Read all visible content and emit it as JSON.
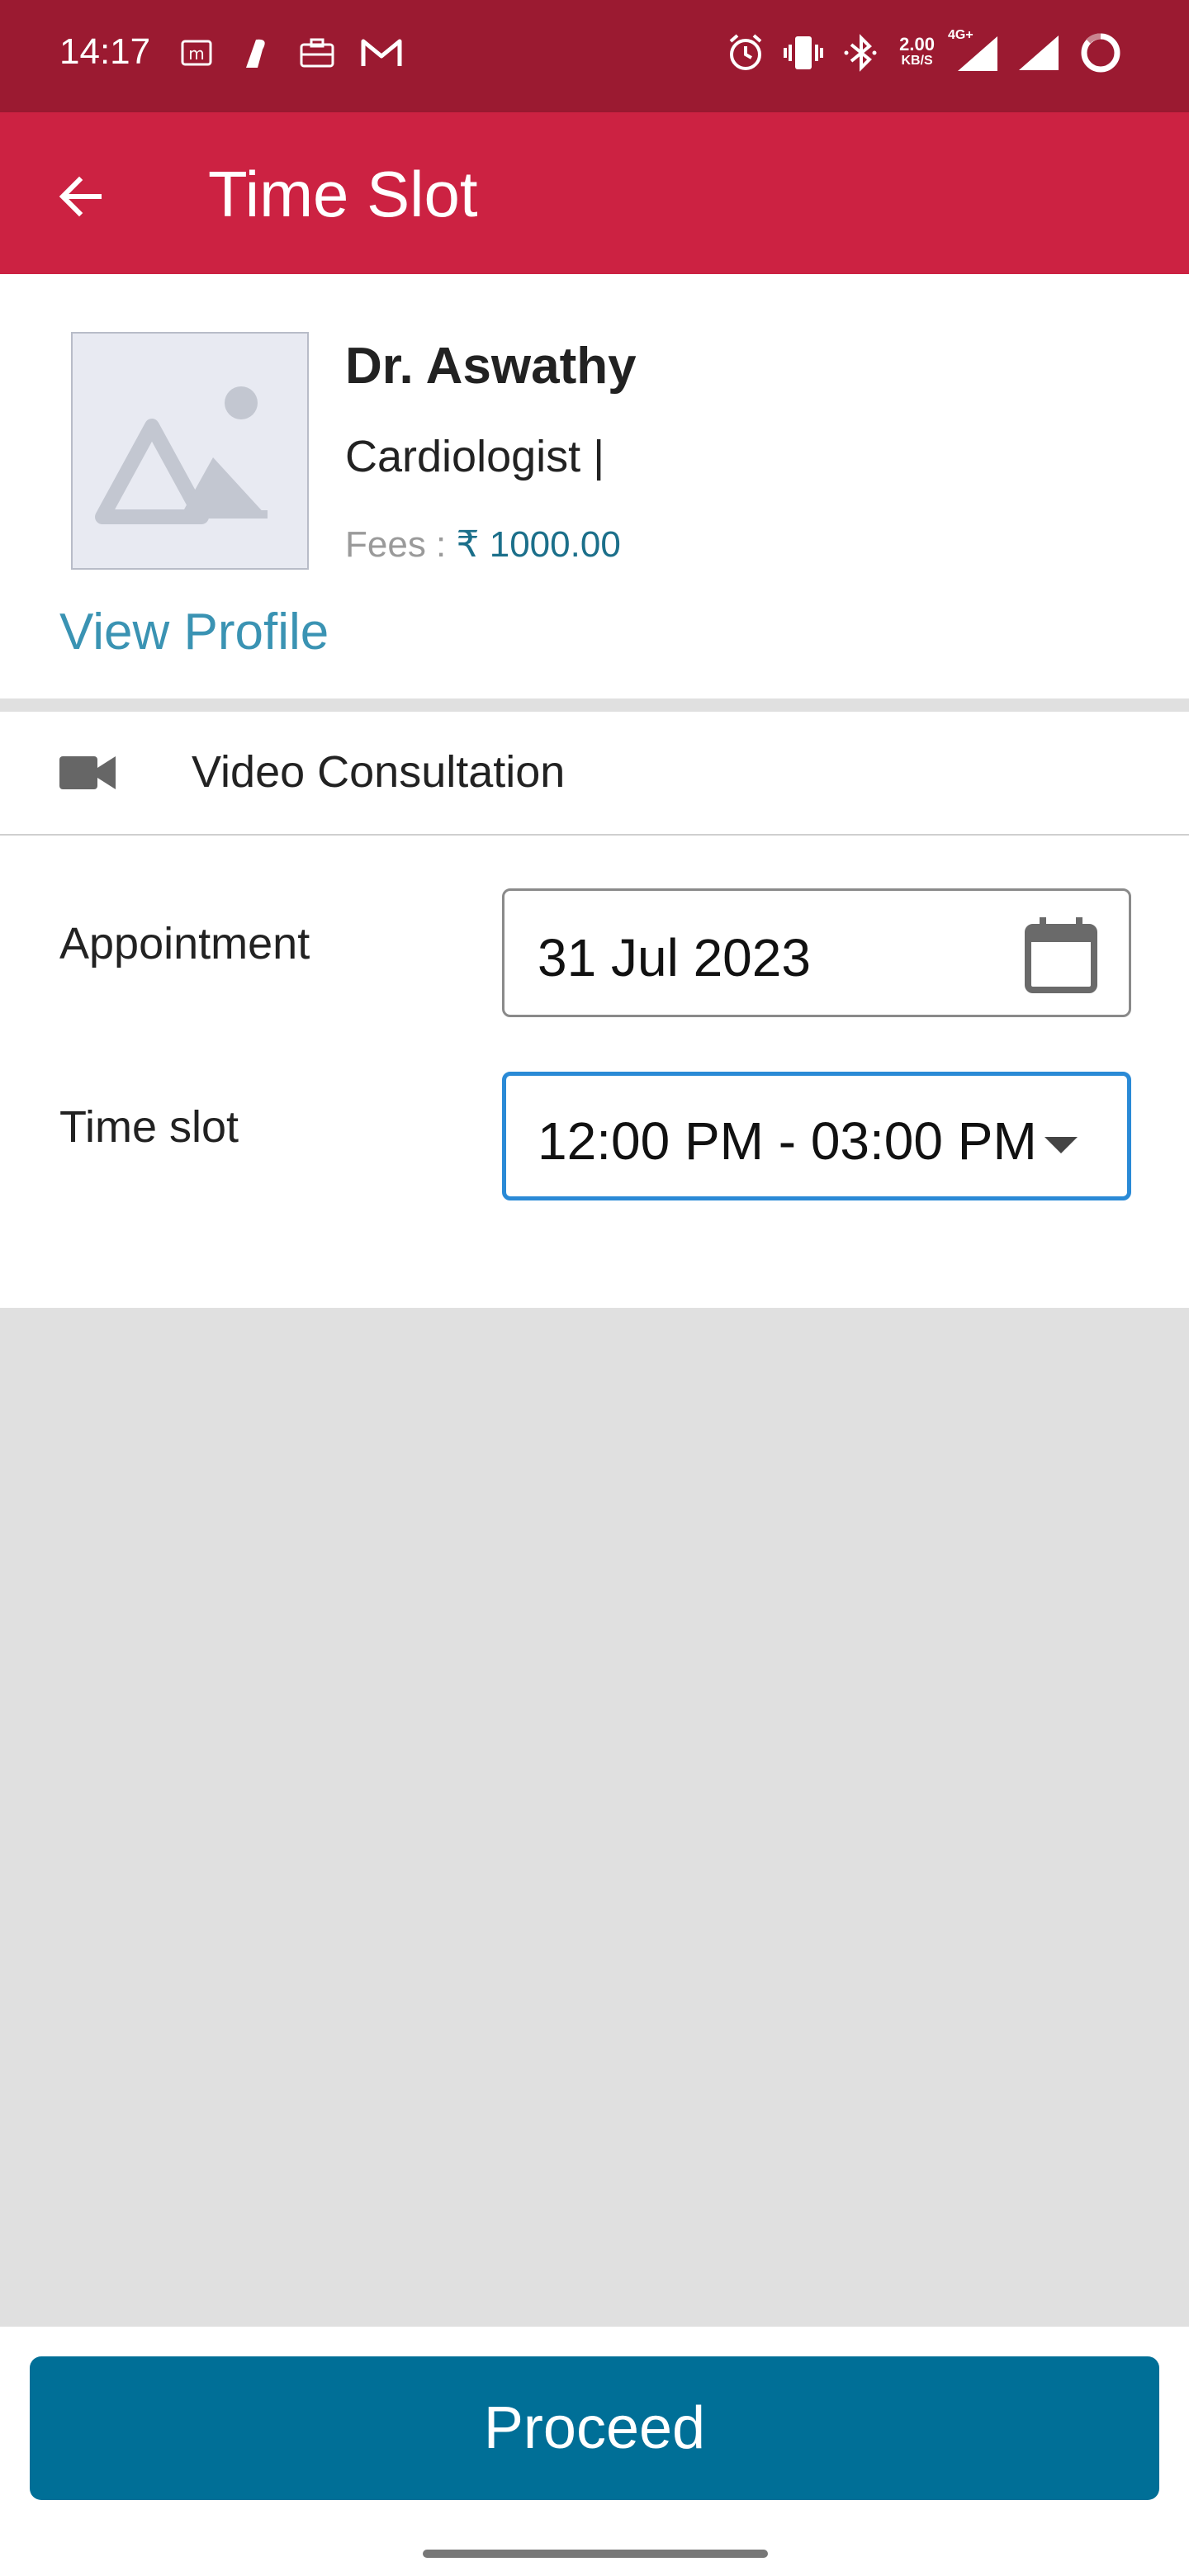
{
  "status_bar": {
    "time": "14:17",
    "left_icons": [
      "m-app-icon",
      "brand-i-icon",
      "briefcase-icon",
      "gmail-icon"
    ],
    "net_speed": "2.00",
    "net_speed_unit": "KB/S",
    "network": "4G+",
    "right_icons": [
      "alarm-icon",
      "vibrate-icon",
      "bluetooth-icon",
      "signal-icon",
      "signal-icon",
      "battery-ring-icon"
    ]
  },
  "appbar": {
    "title": "Time Slot",
    "back_icon": "arrow-left-icon",
    "color": "#cc2242"
  },
  "doctor": {
    "name": "Dr. Aswathy",
    "specialty": "Cardiologist |",
    "fees_label": "Fees :",
    "fees_value": "₹ 1000.00",
    "view_profile": "View Profile",
    "photo_icon": "image-placeholder-icon"
  },
  "consultation": {
    "icon": "video-camera-icon",
    "label": "Video Consultation"
  },
  "form": {
    "appointment_label": "Appointment",
    "appointment_date": "31 Jul 2023",
    "time_slot_label": "Time slot",
    "time_slot_value": "12:00 PM - 03:00 PM"
  },
  "footer": {
    "proceed_label": "Proceed",
    "button_color": "#006f97"
  }
}
